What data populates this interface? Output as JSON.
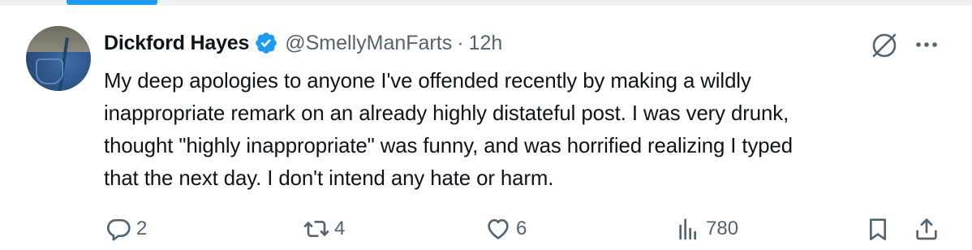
{
  "author": {
    "name": "Dickford Hayes",
    "handle": "@SmellyManFarts",
    "time": "12h",
    "separator": "·",
    "verified": true,
    "verified_color": "#1d9bf0"
  },
  "tweet": {
    "lines": [
      "My deep apologies to anyone I've offended recently by making a wildly",
      "inappropriate remark on an already highly distateful post. I was very drunk,",
      "thought \"highly inappropriate\" was funny, and was horrified realizing I typed",
      "that the next day. I don't intend any hate or harm."
    ]
  },
  "actions": {
    "replies": "2",
    "reposts": "4",
    "likes": "6",
    "views": "780"
  },
  "icons": [
    "reply-icon",
    "repost-icon",
    "like-icon",
    "views-icon",
    "bookmark-icon",
    "share-icon",
    "grok-icon",
    "more-icon",
    "verified-badge-icon"
  ],
  "colors": {
    "text": "#0f1419",
    "secondary": "#536471",
    "accent": "#1d9bf0"
  }
}
